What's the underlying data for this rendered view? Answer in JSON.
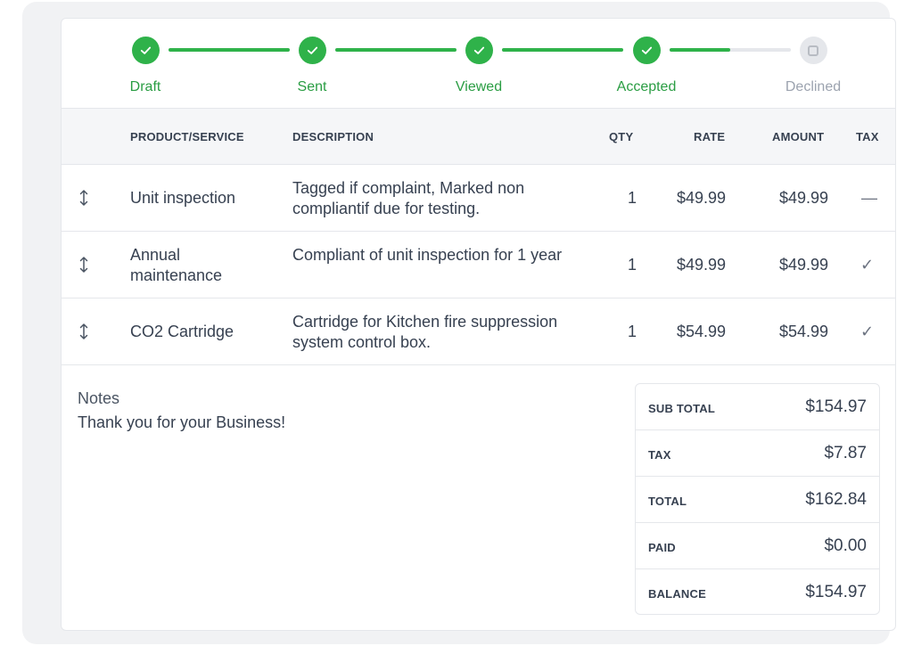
{
  "progress": {
    "steps": [
      {
        "label": "Draft",
        "status": "done"
      },
      {
        "label": "Sent",
        "status": "done"
      },
      {
        "label": "Viewed",
        "status": "done"
      },
      {
        "label": "Accepted",
        "status": "done"
      },
      {
        "label": "Declined",
        "status": "todo"
      }
    ],
    "last_segment_fill": 0.5,
    "colors": {
      "done": "#2fb24a",
      "track": "#e5e7eb"
    }
  },
  "table": {
    "headers": {
      "product": "PRODUCT/SERVICE",
      "description": "DESCRIPTION",
      "qty": "QTY",
      "rate": "RATE",
      "amount": "AMOUNT",
      "tax": "TAX"
    },
    "rows": [
      {
        "product": "Unit inspection",
        "description": "Tagged if complaint, Marked non compliantif due for testing.",
        "qty": "1",
        "rate": "$49.99",
        "amount": "$49.99",
        "tax": "—",
        "taxable": false
      },
      {
        "product": "Annual maintenance",
        "description": "Compliant of unit inspection for 1 year",
        "qty": "1",
        "rate": "$49.99",
        "amount": "$49.99",
        "tax": "✓",
        "taxable": true
      },
      {
        "product": "CO2 Cartridge",
        "description": "Cartridge for Kitchen fire suppression system control box.",
        "qty": "1",
        "rate": "$54.99",
        "amount": "$54.99",
        "tax": "✓",
        "taxable": true
      }
    ]
  },
  "notes": {
    "title": "Notes",
    "text": "Thank you for your Business!"
  },
  "totals": [
    {
      "label": "SUB TOTAL",
      "value": "$154.97"
    },
    {
      "label": "TAX",
      "value": "$7.87"
    },
    {
      "label": "TOTAL",
      "value": "$162.84"
    },
    {
      "label": "PAID",
      "value": "$0.00"
    },
    {
      "label": "BALANCE",
      "value": "$154.97"
    }
  ]
}
